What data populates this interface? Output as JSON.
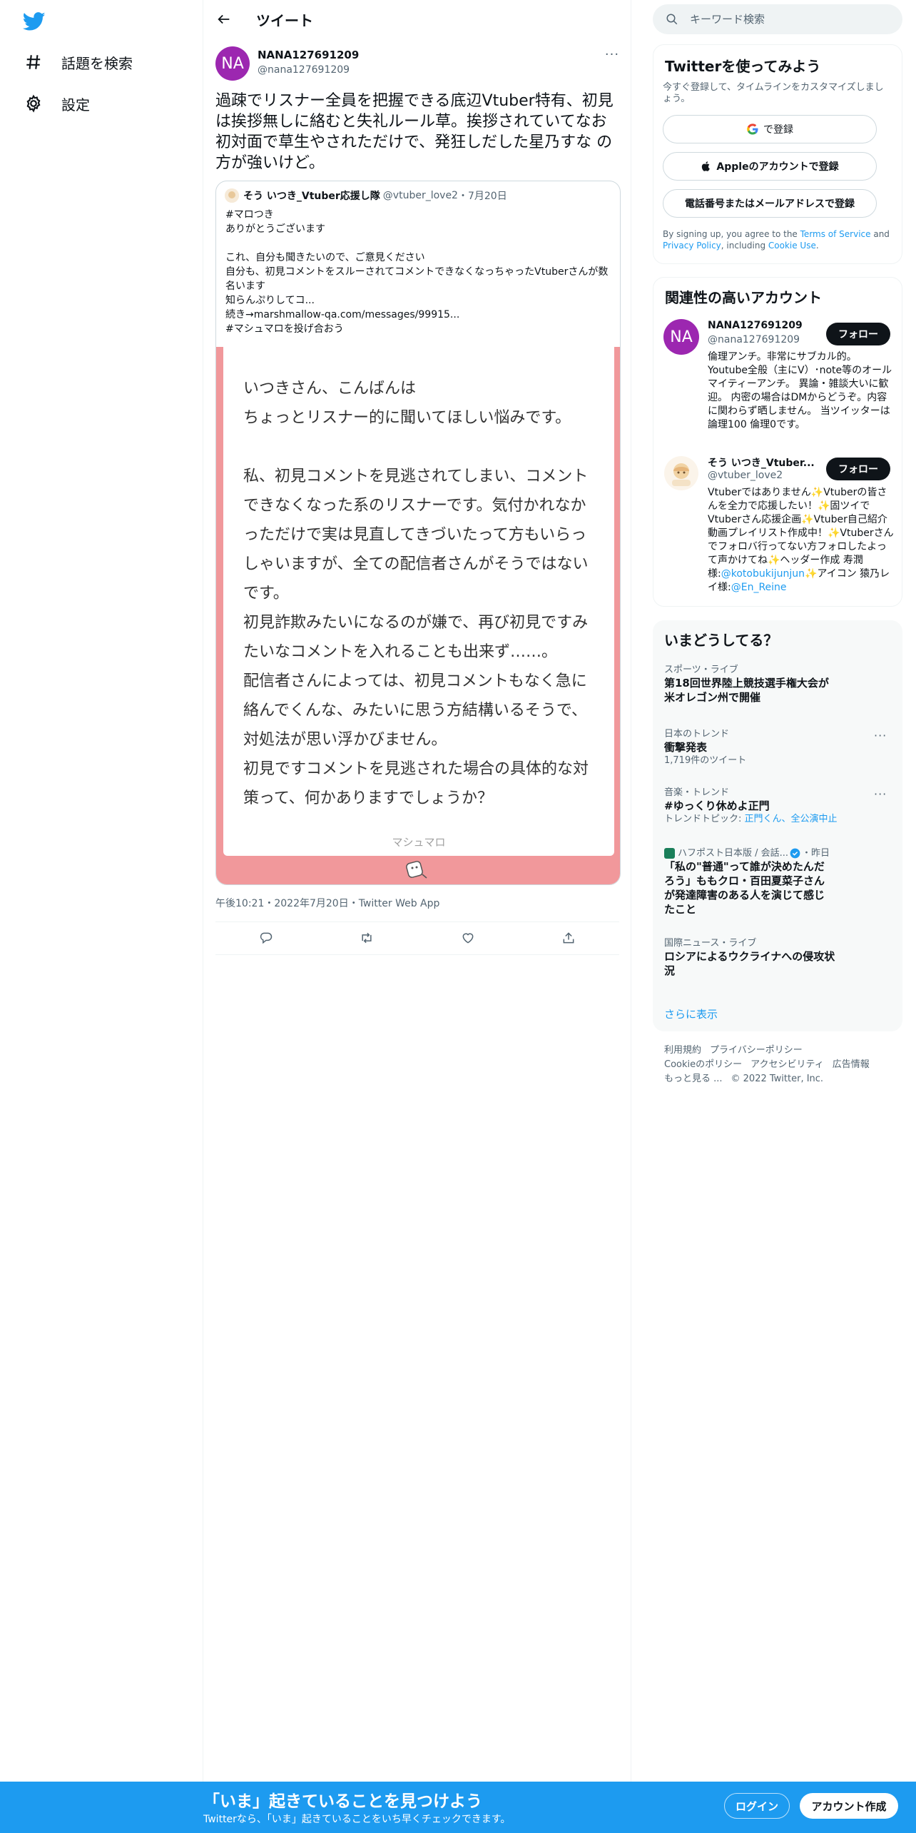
{
  "colors": {
    "brand": "#1d9bf0",
    "text_primary": "#0f1419",
    "text_secondary": "#536471",
    "marshmallow_pink": "#f1989b",
    "avatar_purple": "#9c27b0",
    "verified": "#1d9bf0"
  },
  "sidebar": {
    "logo_icon": "twitter-bird-icon",
    "items": [
      {
        "label": "話題を検索",
        "icon": "hashtag-icon"
      },
      {
        "label": "設定",
        "icon": "gear-icon"
      }
    ]
  },
  "header": {
    "back_icon": "arrow-left-icon",
    "title": "ツイート"
  },
  "tweet": {
    "avatar_initials": "NA",
    "name": "NANA127691209",
    "handle": "@nana127691209",
    "more": "···",
    "text": "過疎でリスナー全員を把握できる底辺Vtuber特有、初見は挨拶無しに絡むと失礼ルール草。挨拶されていてなお初対面で草生やされただけで、発狂しだした星乃すな の方が強いけど。",
    "timestamp": "午後10:21・2022年7月20日・Twitter Web App",
    "quote": {
      "name": "そう いつき_Vtuber応援し隊",
      "handle": "@vtuber_love2",
      "date": "・7月20日",
      "text": "#マロつき\nありがとうございます\n\nこれ、自分も聞きたいので、ご意見ください\n自分も、初見コメントをスルーされてコメントできなくなっちゃったVtuberさんが数名います\n知らんぷりしてコ...\n続き→marshmallow-qa.com/messages/99915...\n#マシュマロを投げ合おう",
      "marshmallow_text": "いつきさん、こんばんは\nちょっとリスナー的に聞いてほしい悩みです。\n\n私、初見コメントを見逃されてしまい、コメントできなくなった系のリスナーです。気付かれなかっただけで実は見直してきづいたって方もいらっしゃいますが、全ての配信者さんがそうではないです。\n初見詐欺みたいになるのが嫌で、再び初見ですみたいなコメントを入れることも出来ず……。\n配信者さんによっては、初見コメントもなく急に絡んでくんな、みたいに思う方結構いるそうで、対処法が思い浮かびません。\n初見ですコメントを見逃された場合の具体的な対策って、何かありますでしょうか？",
      "marshmallow_brand": "マシュマロ"
    },
    "actions": [
      "reply-icon",
      "retweet-icon",
      "like-icon",
      "share-icon"
    ]
  },
  "search": {
    "placeholder": "キーワード検索"
  },
  "signup": {
    "title": "Twitterを使ってみよう",
    "subtitle": "今すぐ登録して、タイムラインをカスタマイズしましょう。",
    "google": "で登録",
    "apple": "Appleのアカウントで登録",
    "phone": "電話番号またはメールアドレスで登録",
    "terms_prefix": "By signing up, you agree to the ",
    "terms_tos": "Terms of Service",
    "terms_and": " and ",
    "terms_privacy": "Privacy Policy",
    "terms_including": ", including ",
    "terms_cookie": "Cookie Use",
    "terms_end": "."
  },
  "related": {
    "title": "関連性の高いアカウント",
    "accounts": [
      {
        "avatar_initials": "NA",
        "name": "NANA127691209",
        "handle": "@nana127691209",
        "follow": "フォロー",
        "bio": "倫理アンチ。非常にサブカル的。Youtube全般（主にV）･note等のオールマイティーアンチ。 異論・雑談大いに歓迎。 内密の場合はDMからどうぞ。内容に関わらず晒しません。 当ツイッターは 論理100 倫理0です。"
      },
      {
        "name": "そう いつき_Vtuber...",
        "handle": "@vtuber_love2",
        "follow": "フォロー",
        "bio_text": "Vtuberではありません✨Vtuberの皆さんを全力で応援したい！✨固ツイでVtuberさん応援企画✨Vtuber自己紹介動画プレイリスト作成中！✨Vtuberさんでフォロバ行ってない方フォロしたよって声かけてね✨ヘッダー作成 寿潤様:",
        "bio_link1": "@kotobukijunjun",
        "bio_mid": "✨アイコン 猿乃レイ様:",
        "bio_link2": "@En_Reine"
      }
    ]
  },
  "trends": {
    "title": "いまどうしてる？",
    "items": [
      {
        "meta": "スポーツ・ライブ",
        "title": "第18回世界陸上競技選手権大会が米オレゴン州で開催"
      },
      {
        "meta": "日本のトレンド",
        "title": "衝撃発表",
        "sub": "1,719件のツイート",
        "more": "···"
      },
      {
        "meta": "音楽・トレンド",
        "title": "#ゆっくり休めよ正門",
        "sub_prefix": "トレンドトピック: ",
        "sub_links": "正門くん、全公演中止",
        "more": "···"
      },
      {
        "meta_source": "ハフポスト日本版 / 会話...",
        "meta_time": "・昨日",
        "title": "「私の\"普通\"って誰が決めたんだろう」ももクロ・百田夏菜子さんが発達障害のある人を演じて感じたこと"
      },
      {
        "meta": "国際ニュース・ライブ",
        "title": "ロシアによるウクライナへの侵攻状況"
      }
    ],
    "show_more": "さらに表示"
  },
  "footer": {
    "links": [
      "利用規約",
      "プライバシーポリシー",
      "Cookieのポリシー",
      "アクセシビリティ",
      "広告情報",
      "もっと見る ..."
    ],
    "copyright": "© 2022 Twitter, Inc."
  },
  "bottom_bar": {
    "title": "「いま」起きていることを見つけよう",
    "subtitle": "Twitterなら、「いま」起きていることをいち早くチェックできます。",
    "login": "ログイン",
    "signup": "アカウント作成"
  }
}
